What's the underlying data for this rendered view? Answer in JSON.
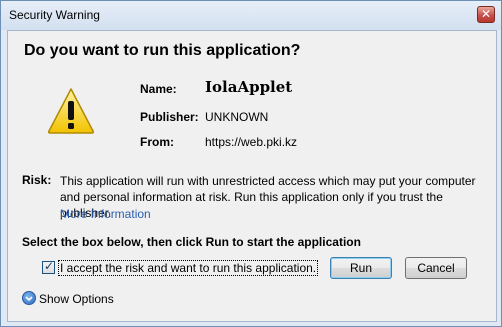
{
  "window": {
    "title": "Security Warning",
    "close_glyph": "✕"
  },
  "dialog": {
    "heading": "Do you want to run this application?",
    "icon": "warning-triangle-icon",
    "fields": {
      "name_label": "Name:",
      "name_value": "IolaApplet",
      "publisher_label": "Publisher:",
      "publisher_value": "UNKNOWN",
      "from_label": "From:",
      "from_value": "https://web.pki.kz"
    },
    "risk_label": "Risk:",
    "risk_text": "This application will run with unrestricted access which may put your computer and personal information at risk. Run this application only if you trust the publisher.",
    "more_info_link": "More Information",
    "select_instruction": "Select the box below, then click Run to start the application",
    "accept_checkbox": {
      "checked": true,
      "label": "I accept the risk and want to run this application."
    },
    "run_button": "Run",
    "cancel_button": "Cancel",
    "show_options": "Show Options"
  },
  "colors": {
    "link": "#2a5db0",
    "close_button": "#c75050",
    "warning_yellow": "#f6d020"
  }
}
